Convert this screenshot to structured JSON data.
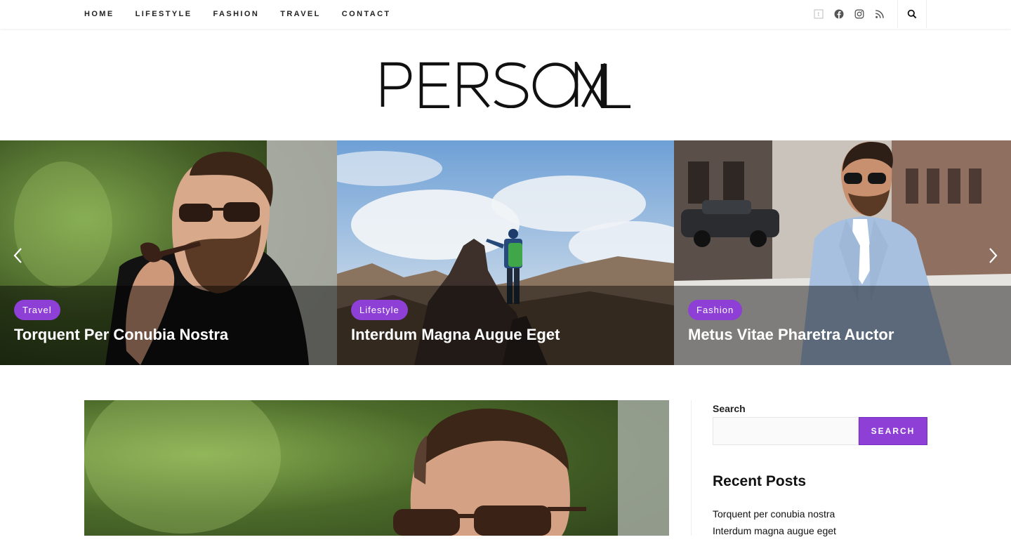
{
  "nav": {
    "items": [
      "HOME",
      "LIFESTYLE",
      "FASHION",
      "TRAVEL",
      "CONTACT"
    ]
  },
  "social": {
    "icons": [
      "tumblr-icon",
      "facebook-icon",
      "instagram-icon",
      "rss-icon"
    ]
  },
  "logo": {
    "text": "PERSONAL"
  },
  "slider": {
    "slides": [
      {
        "category": "Travel",
        "title": "Torquent Per Conubia Nostra"
      },
      {
        "category": "Lifestyle",
        "title": "Interdum Magna Augue Eget"
      },
      {
        "category": "Fashion",
        "title": "Metus Vitae Pharetra Auctor"
      }
    ]
  },
  "sidebar": {
    "search_label": "Search",
    "search_placeholder": "",
    "search_button": "SEARCH",
    "recent_heading": "Recent Posts",
    "recent_posts": [
      "Torquent per conubia nostra",
      "Interdum magna augue eget"
    ]
  },
  "colors": {
    "accent": "#8d3fd6"
  }
}
